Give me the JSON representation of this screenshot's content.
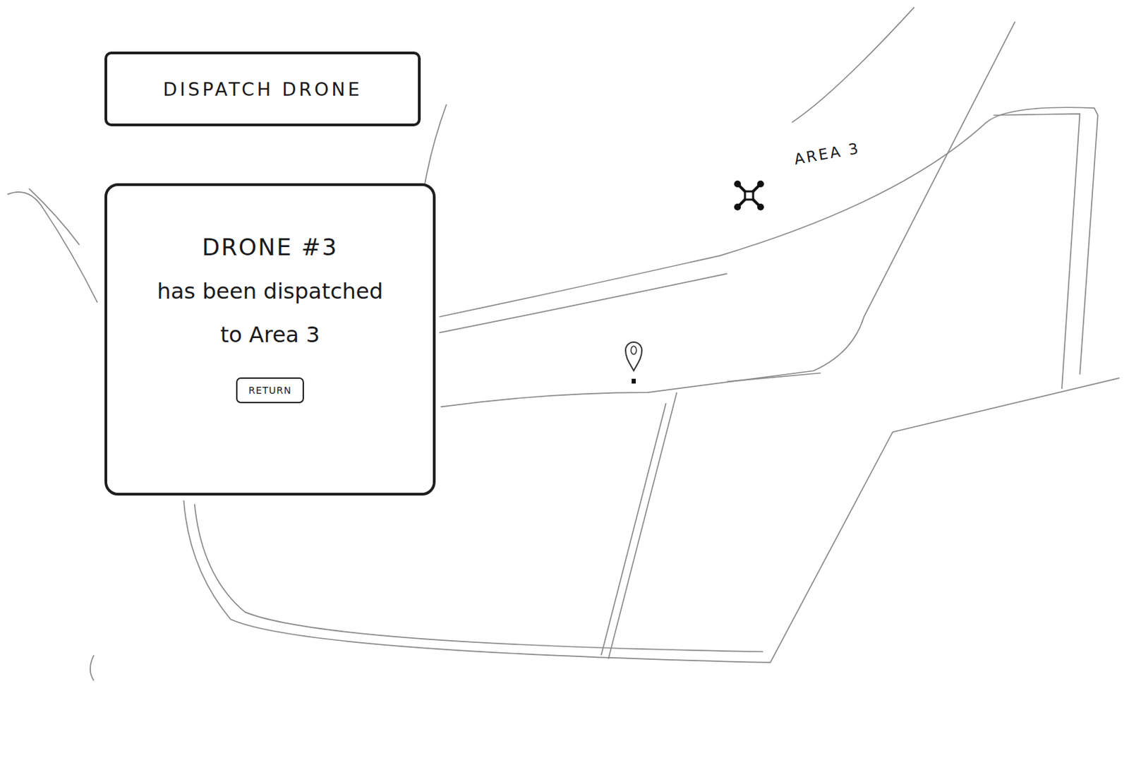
{
  "dispatch_button": {
    "label": "DISPATCH DRONE"
  },
  "dialog": {
    "title": "DRONE #3",
    "lines": [
      "has been dispatched",
      "to Area 3"
    ],
    "button": "RETURN"
  },
  "map": {
    "areas": [
      {
        "label": "AREA 3"
      }
    ]
  }
}
